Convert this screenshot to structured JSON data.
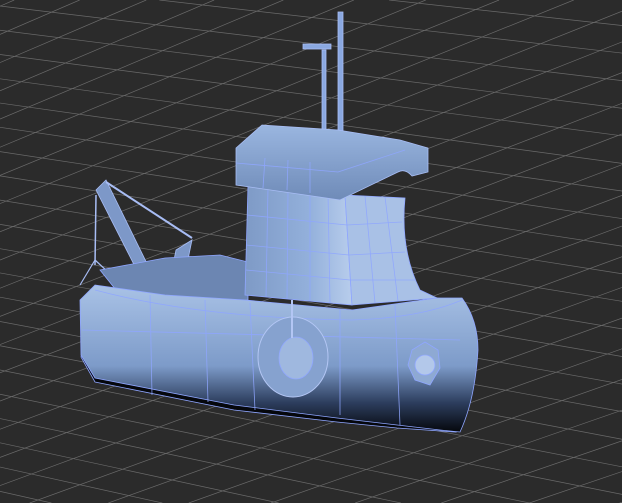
{
  "viewport": {
    "background_color": "#2b2b2b",
    "grid_color": "#6a6a6a",
    "model_color": "#8fb0dc",
    "wire_color": "#8fa6ff",
    "shadow_color": "#05070c"
  },
  "model": {
    "icon": "tugboat-mesh-icon"
  }
}
